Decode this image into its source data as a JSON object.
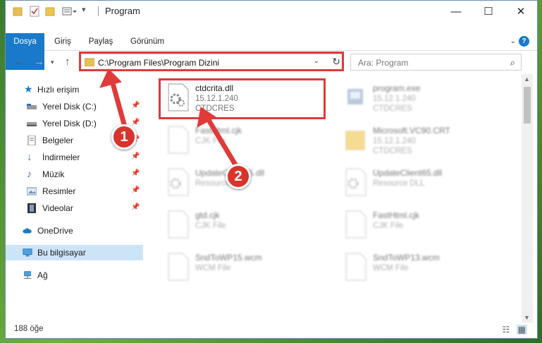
{
  "window": {
    "title": "Program"
  },
  "ribbon": {
    "tabs": [
      "Dosya",
      "Giriş",
      "Paylaş",
      "Görünüm"
    ],
    "help": "?"
  },
  "address": {
    "path": "C:\\Program Files\\Program Dizini"
  },
  "search": {
    "placeholder": "Ara: Program"
  },
  "sidebar": {
    "items": [
      {
        "label": "Hızlı erişim",
        "icon": "star-icon"
      },
      {
        "label": "Yerel Disk (C:)",
        "icon": "drive-icon",
        "pinned": true
      },
      {
        "label": "Yerel Disk (D:)",
        "icon": "drive-icon",
        "pinned": true
      },
      {
        "label": "Belgeler",
        "icon": "document-icon",
        "pinned": true
      },
      {
        "label": "İndirmeler",
        "icon": "download-icon",
        "pinned": true
      },
      {
        "label": "Müzik",
        "icon": "music-icon",
        "pinned": true
      },
      {
        "label": "Resimler",
        "icon": "picture-icon",
        "pinned": true
      },
      {
        "label": "Videolar",
        "icon": "video-icon",
        "pinned": true
      },
      {
        "label": "OneDrive",
        "icon": "cloud-icon"
      },
      {
        "label": "Bu bilgisayar",
        "icon": "computer-icon",
        "selected": true
      },
      {
        "label": "Ağ",
        "icon": "network-icon"
      }
    ]
  },
  "files": [
    {
      "name": "ctdcrita.dll",
      "version": "15.12.1.240",
      "type": "CTDCRES",
      "icon": "dll-gear-icon"
    },
    {
      "name": "program.exe",
      "version": "15.12.1.240",
      "type": "CTDCRES",
      "icon": "exe-icon"
    },
    {
      "name": "FastHtml.cjk",
      "version": "CJK File",
      "type": "",
      "icon": "file-icon"
    },
    {
      "name": "Microsoft.VC90.CRT",
      "version": "15.12.1.240",
      "type": "CTDCRES",
      "icon": "folder-icon"
    },
    {
      "name": "UpdateClient65.dll",
      "version": "Resource DLL",
      "type": "",
      "icon": "dll-gear-icon"
    },
    {
      "name": "UpdateClient65.dll",
      "version": "Resource DLL",
      "type": "",
      "icon": "dll-gear-icon"
    },
    {
      "name": "gtd.cjk",
      "version": "CJK File",
      "type": "",
      "icon": "file-icon"
    },
    {
      "name": "FastHtml.cjk",
      "version": "CJK File",
      "type": "",
      "icon": "file-icon"
    },
    {
      "name": "SndToWP15.wcm",
      "version": "WCM File",
      "type": "",
      "icon": "file-icon"
    },
    {
      "name": "SndToWP13.wcm",
      "version": "WCM File",
      "type": "",
      "icon": "file-icon"
    }
  ],
  "status": {
    "count": "188 öğe"
  },
  "annotations": {
    "badge1": "1",
    "badge2": "2"
  },
  "colors": {
    "accent": "#1979ca",
    "highlight": "#e03a3a",
    "badge": "#d9342b"
  }
}
